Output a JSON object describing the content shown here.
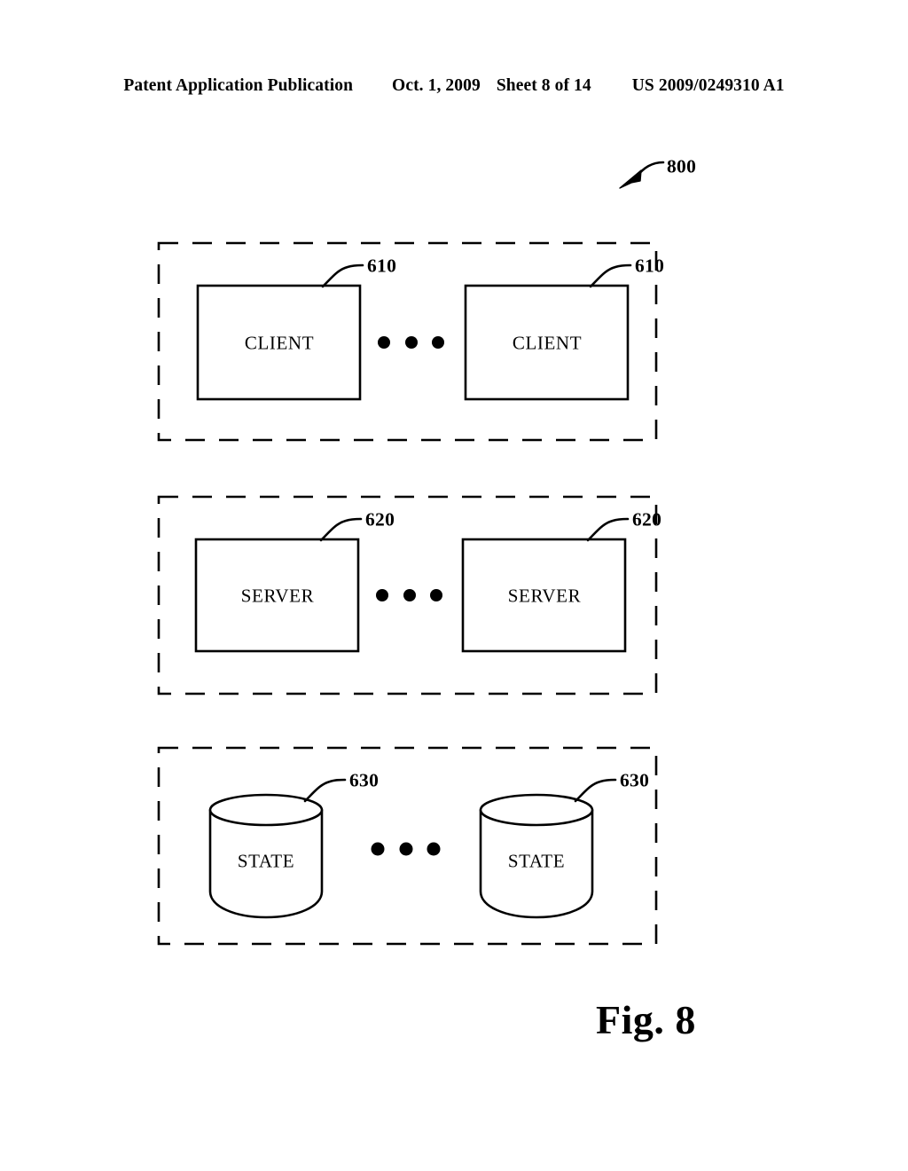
{
  "header": {
    "publication": "Patent Application Publication",
    "date": "Oct. 1, 2009",
    "sheet": "Sheet 8 of 14",
    "publication_number": "US 2009/0249310 A1"
  },
  "figure": {
    "caption": "Fig. 8",
    "system_ref": "800",
    "groups": [
      {
        "id": "client-tier",
        "ref": "610",
        "shape": "rectangle",
        "nodes": [
          {
            "label": "CLIENT",
            "ref": "610"
          },
          {
            "label": "CLIENT",
            "ref": "610"
          }
        ],
        "ellipsis": "• • •"
      },
      {
        "id": "server-tier",
        "ref": "620",
        "shape": "rectangle",
        "nodes": [
          {
            "label": "SERVER",
            "ref": "620"
          },
          {
            "label": "SERVER",
            "ref": "620"
          }
        ],
        "ellipsis": "• • •"
      },
      {
        "id": "state-tier",
        "ref": "630",
        "shape": "cylinder",
        "nodes": [
          {
            "label": "STATE",
            "ref": "630"
          },
          {
            "label": "STATE",
            "ref": "630"
          }
        ],
        "ellipsis": "• • •"
      }
    ]
  },
  "colors": {
    "ink": "#000000",
    "page": "#ffffff"
  }
}
